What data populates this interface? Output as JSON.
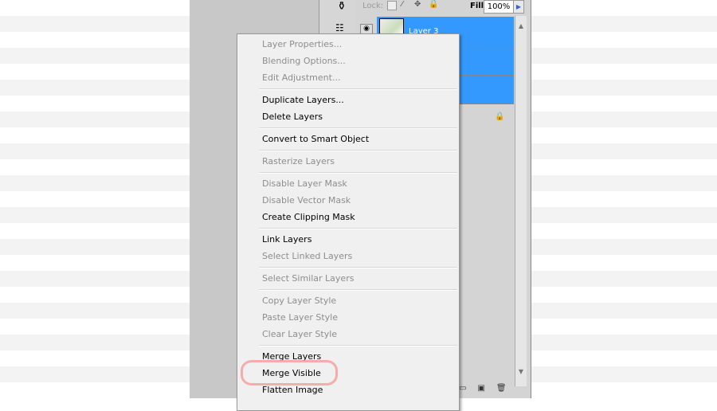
{
  "panel": {
    "lock_label": "Lock:",
    "fill_label": "Fill:",
    "fill_value": "100%",
    "layer_name": "Layer 3"
  },
  "menu": {
    "groups": [
      [
        {
          "label": "Layer Properties...",
          "enabled": false
        },
        {
          "label": "Blending Options...",
          "enabled": false
        },
        {
          "label": "Edit Adjustment...",
          "enabled": false
        }
      ],
      [
        {
          "label": "Duplicate Layers...",
          "enabled": true
        },
        {
          "label": "Delete Layers",
          "enabled": true
        }
      ],
      [
        {
          "label": "Convert to Smart Object",
          "enabled": true
        }
      ],
      [
        {
          "label": "Rasterize Layers",
          "enabled": false
        }
      ],
      [
        {
          "label": "Disable Layer Mask",
          "enabled": false
        },
        {
          "label": "Disable Vector Mask",
          "enabled": false
        },
        {
          "label": "Create Clipping Mask",
          "enabled": true
        }
      ],
      [
        {
          "label": "Link Layers",
          "enabled": true
        },
        {
          "label": "Select Linked Layers",
          "enabled": false
        }
      ],
      [
        {
          "label": "Select Similar Layers",
          "enabled": false
        }
      ],
      [
        {
          "label": "Copy Layer Style",
          "enabled": false
        },
        {
          "label": "Paste Layer Style",
          "enabled": false
        },
        {
          "label": "Clear Layer Style",
          "enabled": false
        }
      ],
      [
        {
          "label": "Merge Layers",
          "enabled": true
        },
        {
          "label": "Merge Visible",
          "enabled": true,
          "highlighted": true
        },
        {
          "label": "Flatten Image",
          "enabled": true
        }
      ]
    ]
  },
  "colors": {
    "selection": "#3399ff",
    "highlight_circle": "#f6a0a0"
  }
}
